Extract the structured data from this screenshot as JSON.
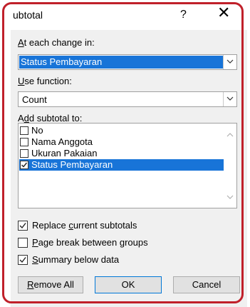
{
  "window": {
    "title": "ubtotal",
    "help_label": "?",
    "close_label": "✕"
  },
  "at_each_change": {
    "label_accel": "A",
    "label_rest": "t each change in:",
    "value": "Status Pembayaran"
  },
  "use_function": {
    "label_accel": "U",
    "label_rest": "se function:",
    "value": "Count"
  },
  "add_subtotal": {
    "label_pre": "A",
    "label_accel": "d",
    "label_rest": "d subtotal to:",
    "items": [
      {
        "label": "No",
        "checked": false,
        "selected": false
      },
      {
        "label": "Nama Anggota",
        "checked": false,
        "selected": false
      },
      {
        "label": "Ukuran Pakaian",
        "checked": false,
        "selected": false
      },
      {
        "label": "Status Pembayaran",
        "checked": true,
        "selected": true
      }
    ]
  },
  "options": {
    "replace": {
      "pre": "Replace ",
      "accel": "c",
      "rest": "urrent subtotals",
      "checked": true
    },
    "page_break": {
      "pre": "",
      "accel": "P",
      "rest": "age break between groups",
      "checked": false
    },
    "summary": {
      "pre": "",
      "accel": "S",
      "rest": "ummary below data",
      "checked": true
    }
  },
  "buttons": {
    "remove_all_accel": "R",
    "remove_all_rest": "emove All",
    "ok": "OK",
    "cancel": "Cancel"
  },
  "colors": {
    "selection": "#1874d8",
    "highlight_outline": "#c0202a"
  }
}
